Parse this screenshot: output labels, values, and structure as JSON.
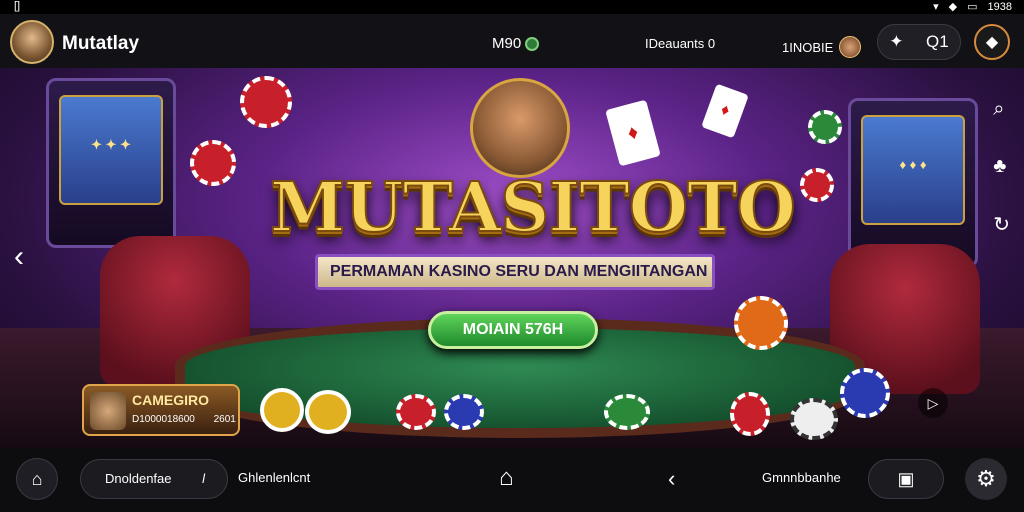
{
  "status_bar": {
    "left": "[]",
    "time": "1938"
  },
  "header": {
    "app_name": "Mutatlay",
    "coins": "M90",
    "deposits": "IDeauants  0",
    "profile_name": "1INOBIE",
    "stars_count": "Q1"
  },
  "banner": {
    "title": "MUTASITOTO",
    "subtitle": "PERMAMAN KASINO SERU DAN MENGIITANGAN",
    "play_button": "MOIAIN 576H",
    "promo": {
      "title": "CAMEGIRO",
      "code": "D1000018600",
      "value": "2601"
    }
  },
  "bottom_bar": {
    "search_value": "Dnoldenfae",
    "search_cursor": "l",
    "notif_label": "Ghlenlenlcnt",
    "games_label": "Gmnnbbanhe"
  },
  "colors": {
    "accent_gold": "#f6d35a",
    "accent_green": "#1e8a2c",
    "bg": "#0b0b0f"
  }
}
